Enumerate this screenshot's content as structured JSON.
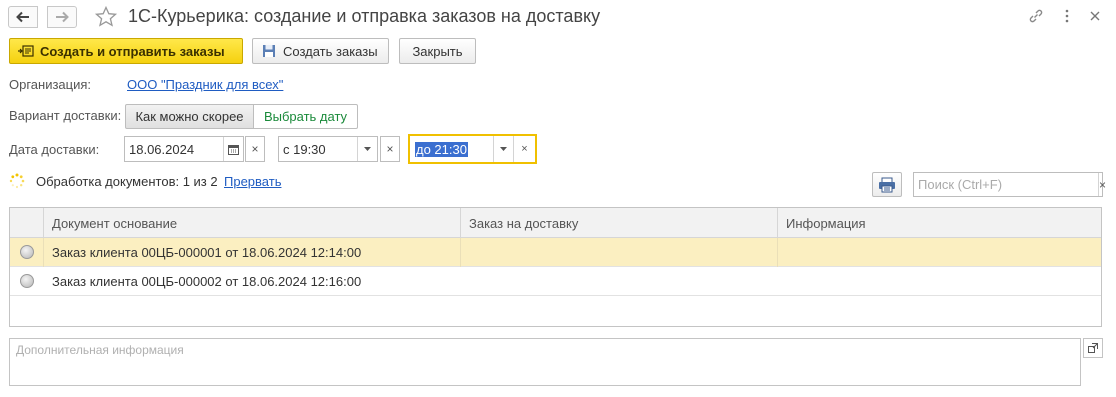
{
  "window": {
    "title": "1С-Курьерика: создание и отправка заказов на доставку",
    "icons": [
      "arrow-left-icon",
      "arrow-right-icon",
      "star-icon",
      "link-icon",
      "more-vertical-icon",
      "close-icon"
    ]
  },
  "toolbar": {
    "create_send_label": "Создать и отправить заказы",
    "create_label": "Создать заказы",
    "close_label": "Закрыть"
  },
  "form": {
    "organization_label": "Организация:",
    "organization_value": "ООО \"Праздник для всех\"",
    "delivery_variant_label": "Вариант доставки:",
    "delivery_variant_options": [
      "Как можно скорее",
      "Выбрать дату"
    ],
    "delivery_variant_selected": "Выбрать дату",
    "delivery_date_label": "Дата доставки:",
    "delivery_date_value": "18.06.2024",
    "time_from_value": "с 19:30",
    "time_to_value": "до 21:30"
  },
  "status": {
    "processing_text": "Обработка документов: 1 из 2",
    "interrupt_link": "Прервать"
  },
  "search": {
    "placeholder": "Поиск (Ctrl+F)"
  },
  "table": {
    "columns": [
      "Документ основание",
      "Заказ на доставку",
      "Информация"
    ],
    "rows": [
      {
        "document": "Заказ клиента 00ЦБ-000001 от 18.06.2024 12:14:00",
        "delivery_order": "",
        "info": "",
        "selected": true
      },
      {
        "document": "Заказ клиента 00ЦБ-000002 от 18.06.2024 12:16:00",
        "delivery_order": "",
        "info": "",
        "selected": false
      }
    ]
  },
  "additional_info": {
    "placeholder": "Дополнительная информация"
  },
  "colors": {
    "primary_button": "#f5d10f",
    "selected_row": "#fbefc1",
    "link": "#1f5cc2",
    "green_option": "#1a8a3a",
    "focus_border": "#f0c000"
  }
}
